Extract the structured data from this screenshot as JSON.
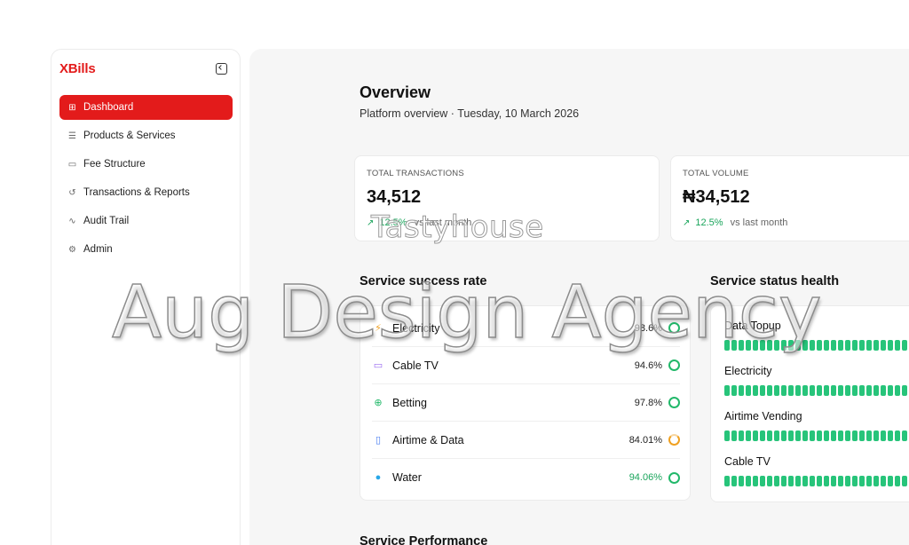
{
  "brand": "XBills",
  "sidebar": {
    "items": [
      {
        "label": "Dashboard",
        "icon": "grid-icon",
        "active": true
      },
      {
        "label": "Products & Services",
        "icon": "server-icon"
      },
      {
        "label": "Fee Structure",
        "icon": "card-icon"
      },
      {
        "label": "Transactions & Reports",
        "icon": "history-icon"
      },
      {
        "label": "Audit Trail",
        "icon": "activity-icon"
      },
      {
        "label": "Admin",
        "icon": "gear-icon"
      }
    ]
  },
  "overview": {
    "title": "Overview",
    "subtitle": "Platform overview · Tuesday, 10 March 2026"
  },
  "stats": [
    {
      "label": "TOTAL TRANSACTIONS",
      "value": "34,512",
      "delta": "12.5%",
      "vs": "vs last month"
    },
    {
      "label": "TOTAL VOLUME",
      "value": "₦34,512",
      "delta": "12.5%",
      "vs": "vs last month"
    }
  ],
  "success_rate": {
    "title": "Service success rate",
    "rows": [
      {
        "name": "Electricity",
        "value": "98.6%",
        "icon": "bolt-icon"
      },
      {
        "name": "Cable TV",
        "value": "94.6%",
        "icon": "tv-icon"
      },
      {
        "name": "Betting",
        "value": "97.8%",
        "icon": "ball-icon"
      },
      {
        "name": "Airtime & Data",
        "value": "84.01%",
        "icon": "phone-icon"
      },
      {
        "name": "Water",
        "value": "94.06%",
        "icon": "drop-icon"
      }
    ]
  },
  "health": {
    "title": "Service status health",
    "items": [
      {
        "name": "Data Topup"
      },
      {
        "name": "Electricity"
      },
      {
        "name": "Airtime Vending"
      },
      {
        "name": "Cable TV"
      }
    ]
  },
  "performance": {
    "title": "Service Performance"
  },
  "watermark": {
    "small": "Tastyhouse",
    "big": "Aug Design Agency"
  },
  "colors": {
    "accent": "#e31b1b",
    "success": "#1ba55c",
    "warning": "#f0a020"
  }
}
